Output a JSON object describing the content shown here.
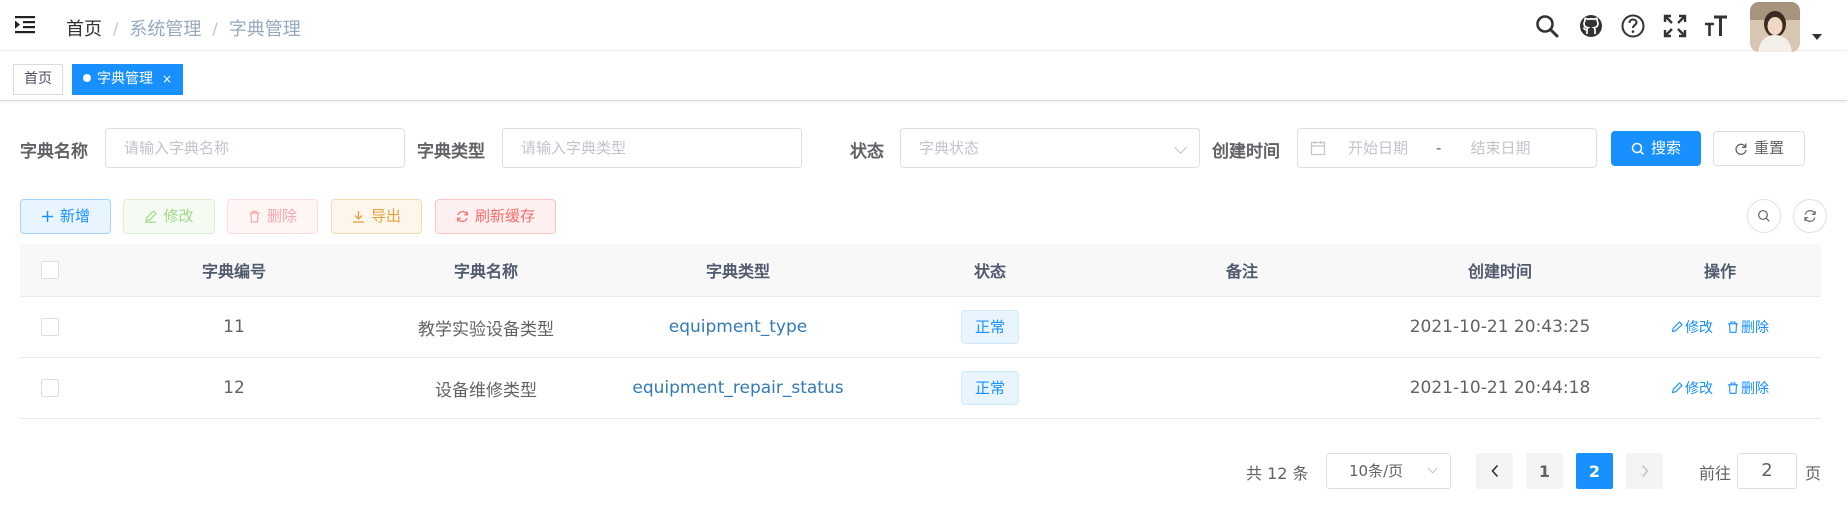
{
  "navbar": {
    "breadcrumb": [
      "首页",
      "系统管理",
      "字典管理"
    ],
    "icons": [
      "search-icon",
      "github-icon",
      "question-icon",
      "fullscreen-icon",
      "font-size-icon"
    ]
  },
  "tags": [
    {
      "label": "首页",
      "active": false
    },
    {
      "label": "字典管理",
      "active": true,
      "close": "×"
    }
  ],
  "search_form": {
    "dict_name_label": "字典名称",
    "dict_name_placeholder": "请输入字典名称",
    "dict_type_label": "字典类型",
    "dict_type_placeholder": "请输入字典类型",
    "status_label": "状态",
    "status_placeholder": "字典状态",
    "created_label": "创建时间",
    "start_placeholder": "开始日期",
    "range_sep": "-",
    "end_placeholder": "结束日期",
    "search_label": "搜索",
    "reset_label": "重置"
  },
  "toolbar": {
    "add_label": "新增",
    "edit_label": "修改",
    "delete_label": "删除",
    "export_label": "导出",
    "refresh_cache_label": "刷新缓存"
  },
  "table": {
    "columns": [
      "字典编号",
      "字典名称",
      "字典类型",
      "状态",
      "备注",
      "创建时间",
      "操作"
    ],
    "rows": [
      {
        "id": "11",
        "name": "教学实验设备类型",
        "type": "equipment_type",
        "status": "正常",
        "remark": "",
        "created": "2021-10-21 20:43:25",
        "edit": "修改",
        "delete": "删除"
      },
      {
        "id": "12",
        "name": "设备维修类型",
        "type": "equipment_repair_status",
        "status": "正常",
        "remark": "",
        "created": "2021-10-21 20:44:18",
        "edit": "修改",
        "delete": "删除"
      }
    ]
  },
  "pagination": {
    "total_text": "共 12 条",
    "page_size": "10条/页",
    "pages": [
      "1",
      "2"
    ],
    "current_page": "2",
    "goto_prefix": "前往",
    "goto_value": "2",
    "goto_suffix": "页"
  },
  "colors": {
    "primary": "#1890ff",
    "success": "#67c23a",
    "danger": "#f56c6c",
    "warning": "#e6a23c"
  }
}
